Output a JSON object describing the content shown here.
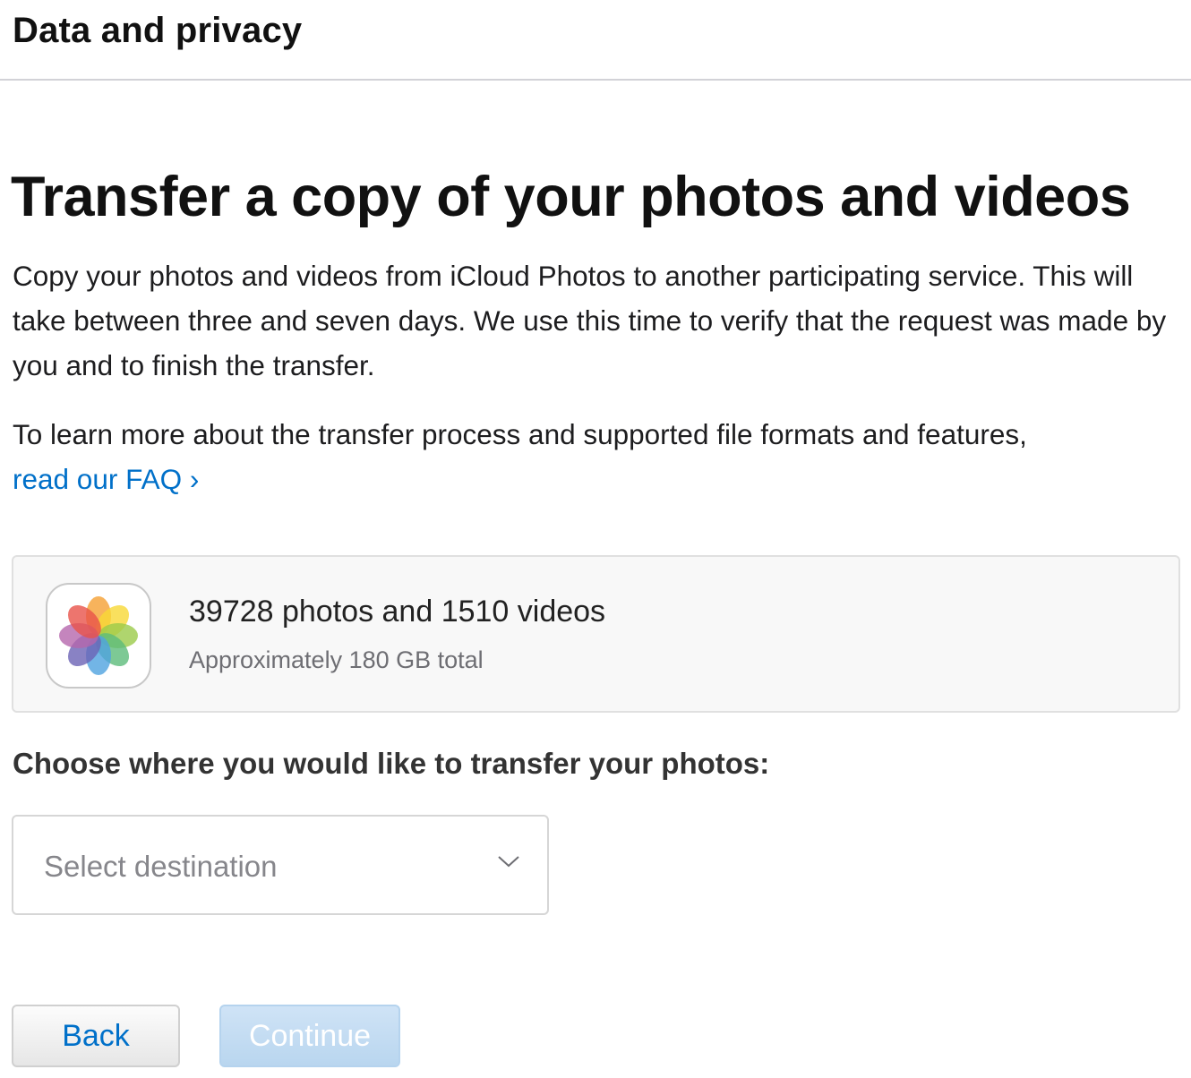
{
  "header": {
    "title": "Data and privacy"
  },
  "main": {
    "title": "Transfer a copy of your photos and videos",
    "description": "Copy your photos and videos from iCloud Photos to another participating service. This will take between three and seven days. We use this time to verify that the request was made by you and to finish the transfer.",
    "learn_more": "To learn more about the transfer process and supported file formats and features,",
    "faq_link": "read our FAQ ›"
  },
  "summary": {
    "icon": "photos-app-icon",
    "count": "39728 photos and 1510 videos",
    "size": "Approximately 180 GB total"
  },
  "destination": {
    "label": "Choose where you would like to transfer your photos:",
    "placeholder": "Select destination",
    "icon": "chevron-down-icon"
  },
  "buttons": {
    "back": "Back",
    "continue": "Continue"
  },
  "colors": {
    "link": "#0070c9",
    "continue_disabled": "#c4dcf2"
  }
}
